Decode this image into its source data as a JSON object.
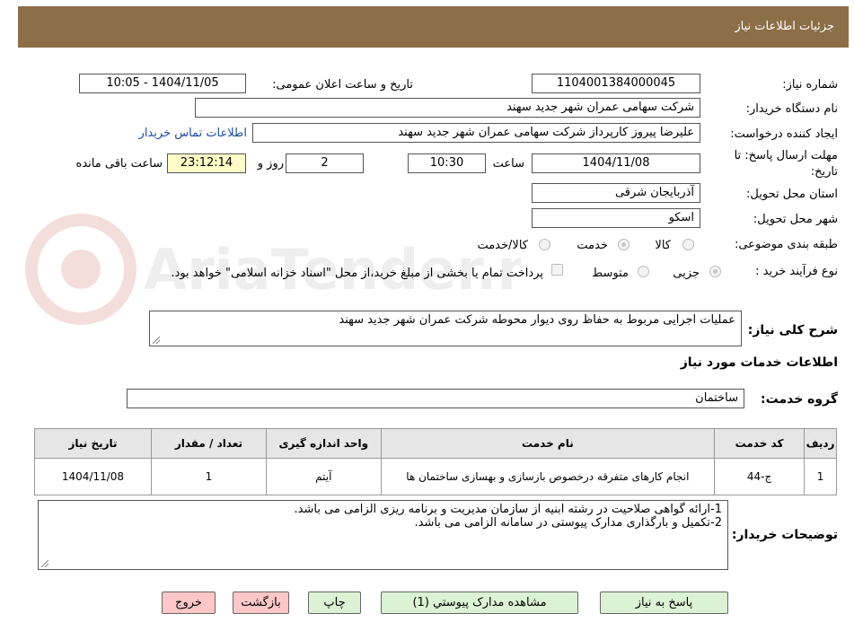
{
  "header": {
    "title": "جزئیات اطلاعات نیاز"
  },
  "form": {
    "need_number_label": "شماره نیاز:",
    "need_number": "1104001384000045",
    "announce_label": "تاریخ و ساعت اعلان عمومی:",
    "announce_value": "1404/11/05 - 10:05",
    "buyer_org_label": "نام دستگاه خریدار:",
    "buyer_org": "شرکت سهامی عمران شهر جدید سهند",
    "requester_label": "ایجاد کننده درخواست:",
    "requester": "علیرضا پیروز کارپرداز شرکت سهامی عمران شهر جدید سهند",
    "contact_link": "اطلاعات تماس خریدار",
    "deadline_label_1": "مهلت ارسال پاسخ: تا",
    "deadline_label_2": "تاریخ:",
    "deadline_date": "1404/11/08",
    "time_label": "ساعت",
    "deadline_time": "10:30",
    "days_value": "2",
    "days_label": "روز و",
    "remaining_time": "23:12:14",
    "remaining_label": "ساعت باقی مانده",
    "province_label": "استان محل تحویل:",
    "province": "آذربایجان شرقی",
    "city_label": "شهر محل تحویل:",
    "city": "اسکو",
    "category_label": "طبقه بندی موضوعی:",
    "category_options": [
      "کالا",
      "خدمت",
      "کالا/خدمت"
    ],
    "process_label": "نوع فرآیند خرید :",
    "process_options": [
      "جزیی",
      "متوسط"
    ],
    "payment_note": "پرداخت تمام یا بخشی از مبلغ خرید،از محل \"اسناد خزانه اسلامی\" خواهد بود."
  },
  "summary": {
    "label": "شرح کلی نیاز:",
    "text": "عملیات اجرایی مربوط به حفاظ روی دیوار محوطه شرکت عمران شهر جدید سهند"
  },
  "services": {
    "section_title": "اطلاعات خدمات مورد نیاز",
    "group_label": "گروه خدمت:",
    "group_value": "ساختمان",
    "columns": [
      "ردیف",
      "کد خدمت",
      "نام خدمت",
      "واحد اندازه گیری",
      "تعداد / مقدار",
      "تاریخ نیاز"
    ],
    "rows": [
      {
        "row": "1",
        "code": "ج-44",
        "name": "انجام کارهای متفرقه درخصوص بازسازی و بهسازی ساختمان ها",
        "unit": "آیتم",
        "qty": "1",
        "date": "1404/11/08"
      }
    ]
  },
  "buyer_notes": {
    "label": "توضیحات خریدار:",
    "line1": "1-ارائه گواهی صلاحیت در رشته ابنیه از سازمان مدیریت و برنامه ریزی الزامی می باشد.",
    "line2": "2-تکمیل و بارگذاری مدارک پیوستی در سامانه الزامی می باشد."
  },
  "buttons": {
    "reply": "پاسخ به نیاز",
    "attachments": "مشاهده مدارک پیوستي (1)",
    "print": "چاپ",
    "back": "بازگشت",
    "exit": "خروج"
  },
  "watermark": {
    "text": "AriaTender.neT"
  },
  "colors": {
    "header_bg": "#8c6e47",
    "link": "#1c4ca8",
    "timer_bg": "#fffcc8",
    "green_btn": "#dbf2d4",
    "pink_btn": "#ffc7c7"
  }
}
